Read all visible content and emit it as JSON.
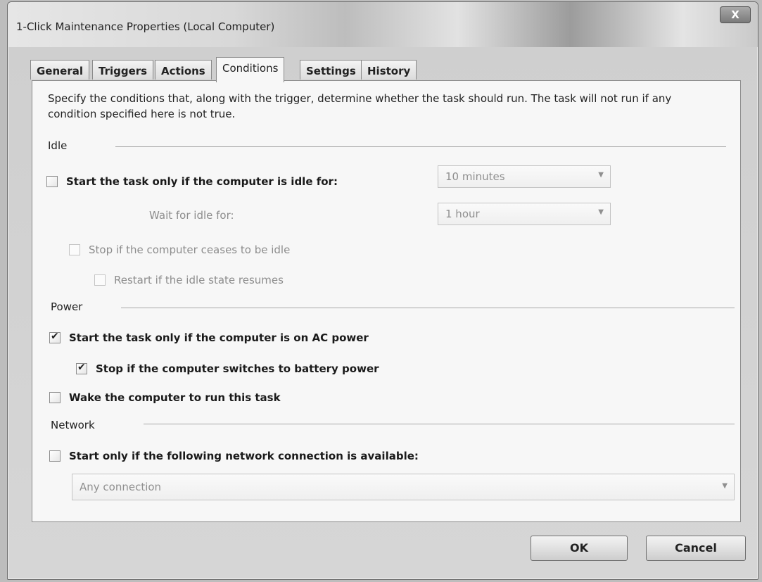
{
  "window": {
    "title": "1-Click Maintenance Properties (Local Computer)",
    "close_label": "X"
  },
  "tabs": [
    "General",
    "Triggers",
    "Actions",
    "Conditions",
    "Settings",
    "History"
  ],
  "description": "Specify the conditions that, along with the trigger, determine whether the task should run.  The task will not run  if any condition specified here is not true.",
  "idle": {
    "label": "Idle",
    "start_if_idle": {
      "label": "Start the task only if the computer is idle for:",
      "checked": false
    },
    "idle_duration": "10 minutes",
    "wait_label": "Wait for idle for:",
    "wait_duration": "1 hour",
    "stop_if_ceases": {
      "label": "Stop if the computer ceases to be idle",
      "checked": false
    },
    "restart_if_resumes": {
      "label": "Restart if the idle state resumes",
      "checked": false
    }
  },
  "power": {
    "label": "Power",
    "ac_power": {
      "label": "Start the task only if the computer is on AC power",
      "checked": true
    },
    "battery_stop": {
      "label": "Stop if the computer switches to battery power",
      "checked": true
    },
    "wake": {
      "label": "Wake the computer to run this task",
      "checked": false
    }
  },
  "network": {
    "label": "Network",
    "start_if_network": {
      "label": "Start only if the following network connection is available:",
      "checked": false
    },
    "connection": "Any connection"
  },
  "buttons": {
    "ok": "OK",
    "cancel": "Cancel"
  }
}
